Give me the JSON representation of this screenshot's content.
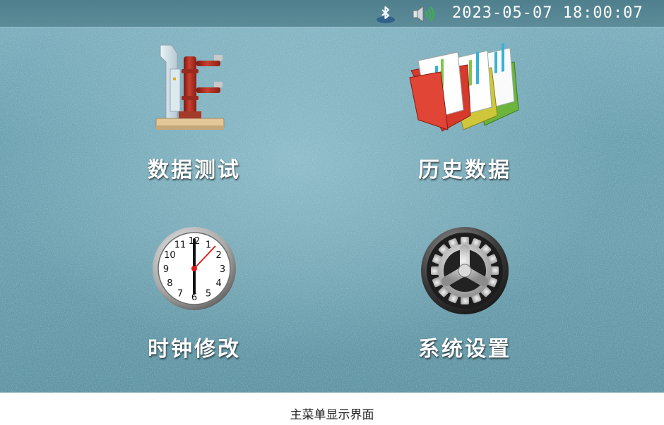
{
  "statusbar": {
    "datetime": "2023-05-07 18:00:07",
    "icons": [
      "bluetooth-icon",
      "speaker-volume-icon"
    ]
  },
  "menu": {
    "items": [
      {
        "label": "数据测试",
        "icon": "vacuum-circuit-breaker-icon"
      },
      {
        "label": "历史数据",
        "icon": "folders-charts-icon"
      },
      {
        "label": "时钟修改",
        "icon": "wall-clock-icon"
      },
      {
        "label": "系统设置",
        "icon": "gear-icon"
      }
    ]
  },
  "clock": {
    "numerals": [
      "12",
      "1",
      "2",
      "3",
      "4",
      "5",
      "6",
      "7",
      "8",
      "9",
      "10",
      "11"
    ],
    "time_shown": "18:00:07"
  },
  "caption": "主菜单显示界面",
  "colors": {
    "background": "#6ea3b2",
    "statusbar": "#557f8c",
    "label_text": "#ffffff",
    "breaker_red": "#b8322a",
    "folder_red": "#d63a2c",
    "folder_yellow": "#c9c23a",
    "folder_green": "#6bb33a"
  }
}
